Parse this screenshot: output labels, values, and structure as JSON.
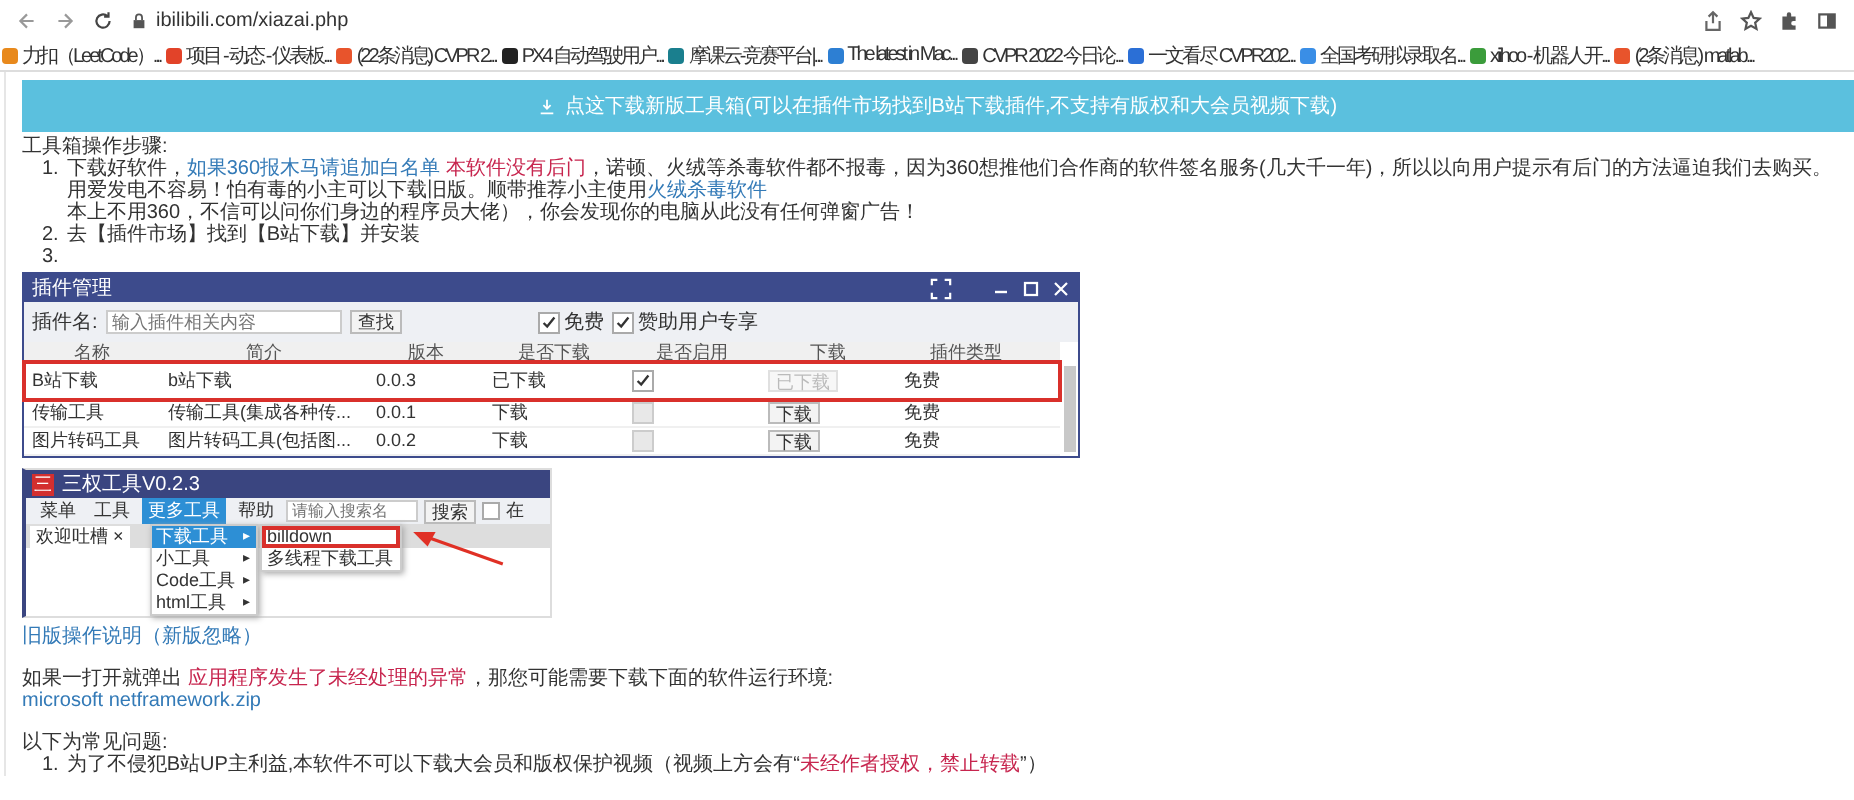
{
  "browser": {
    "url": "ibilibili.com/xiazai.php"
  },
  "bookmarks": [
    {
      "label": "力扣（LeetCode）...",
      "color": "#e8891c"
    },
    {
      "label": "项目 - 动态 - 仪表板...",
      "color": "#e24329"
    },
    {
      "label": "(22条消息) CVPR 2...",
      "color": "#e8542c"
    },
    {
      "label": "PX4 自动驾驶用户...",
      "color": "#222222"
    },
    {
      "label": "摩课云-竞赛平台|...",
      "color": "#1a7f8e"
    },
    {
      "label": "The latest in Mac...",
      "color": "#2d7fd3"
    },
    {
      "label": "CVPR 2022 今日论...",
      "color": "#444444"
    },
    {
      "label": "一文看尽 CVPR202...",
      "color": "#2b6fd6"
    },
    {
      "label": "全国考研拟录取名...",
      "color": "#3a8ee6"
    },
    {
      "label": "xiihoo - 机器人开...",
      "color": "#3b9c3b"
    },
    {
      "label": "(2条消息) matlab...",
      "color": "#e8542c"
    }
  ],
  "banner": {
    "text": "点这下载新版工具箱(可以在插件市场找到B站下载插件,不支持有版权和大会员视频下载)"
  },
  "steps_title": "工具箱操作步骤:",
  "steps": [
    {
      "number": "1.",
      "segments": [
        {
          "kind": "text",
          "text": "下载好软件，"
        },
        {
          "kind": "link",
          "text": "如果360报木马请追加白名单"
        },
        {
          "kind": "alert",
          "text": " 本软件没有后门"
        },
        {
          "kind": "text",
          "text": "，诺顿、火绒等杀毒软件都不报毒，因为360想推他们合作商的软件签名服务(几大千一年)，所以以向用户提示有后门的方法逼迫我们去购买。用爱发电不容易！怕有毒的小主可以下载旧版。顺带推荐小主使用"
        },
        {
          "kind": "link",
          "text": "火绒杀毒软件"
        }
      ],
      "continuation": "本上不用360，不信可以问你们身边的程序员大佬），你会发现你的电脑从此没有任何弹窗广告！"
    },
    {
      "number": "2.",
      "segments": [
        {
          "kind": "text",
          "text": "去【插件市场】找到【B站下载】并安装"
        }
      ]
    },
    {
      "number": "3."
    }
  ],
  "plugin_window": {
    "title": "插件管理",
    "search_label": "插件名:",
    "search": {
      "placeholder": "输入插件相关内容"
    },
    "search_button": "查找",
    "filters": [
      {
        "label": "免费",
        "checked": true
      },
      {
        "label": "赞助用户专享",
        "checked": true
      }
    ],
    "columns": [
      "名称",
      "简介",
      "版本",
      "是否下载",
      "是否启用",
      "下载",
      "插件类型"
    ],
    "rows": [
      {
        "name": "B站下载",
        "intro": "b站下载",
        "version": "0.0.3",
        "status": "已下载",
        "enabled": true,
        "action": "已下载",
        "action_disabled": true,
        "type": "免费",
        "highlighted": true
      },
      {
        "name": "传输工具",
        "intro": "传输工具(集成各种传...",
        "version": "0.0.1",
        "status": "下载",
        "enabled": false,
        "action": "下载",
        "action_disabled": false,
        "type": "免费",
        "highlighted": false
      },
      {
        "name": "图片转码工具",
        "intro": "图片转码工具(包括图...",
        "version": "0.0.2",
        "status": "下载",
        "enabled": false,
        "action": "下载",
        "action_disabled": false,
        "type": "免费",
        "highlighted": false
      }
    ]
  },
  "tool_window": {
    "logo": "三",
    "title": "三权工具V0.2.3",
    "menus": [
      {
        "label": "菜单",
        "selected": false
      },
      {
        "label": "工具",
        "selected": false
      },
      {
        "label": "更多工具",
        "selected": true
      },
      {
        "label": "帮助",
        "selected": false
      }
    ],
    "search": {
      "placeholder": "请输入搜索名"
    },
    "search_button": "搜索",
    "checkbox_checked": false,
    "checkbox_label": "在",
    "tab": {
      "label": "欢迎吐槽",
      "close": "×"
    },
    "dropdown": [
      {
        "label": "下载工具",
        "arrow": "▸",
        "selected": true
      },
      {
        "label": "小工具",
        "arrow": "▸",
        "selected": false
      },
      {
        "label": "Code工具",
        "arrow": "▸",
        "selected": false
      },
      {
        "label": "html工具",
        "arrow": "▸",
        "selected": false
      }
    ],
    "submenu": [
      {
        "label": "billdown",
        "highlighted": true
      },
      {
        "label": "多线程下载工具",
        "highlighted": false
      }
    ]
  },
  "old_link": "旧版操作说明（新版忽略）",
  "error_note": [
    {
      "kind": "text",
      "text": "如果一打开就弹出 "
    },
    {
      "kind": "alert",
      "text": "应用程序发生了未经处理的异常"
    },
    {
      "kind": "text",
      "text": "，那您可能需要下载下面的软件运行环境:"
    }
  ],
  "download_link": "microsoft netframework.zip",
  "faq_title": "以下为常见问题:",
  "faq": [
    {
      "number": "1.",
      "segments": [
        {
          "kind": "text",
          "text": "为了不侵犯B站UP主利益,本软件不可以下载大会员和版权保护视频（视频上方会有“"
        },
        {
          "kind": "alert",
          "text": "未经作者授权，禁止转载"
        },
        {
          "kind": "text",
          "text": "”）"
        }
      ]
    }
  ]
}
